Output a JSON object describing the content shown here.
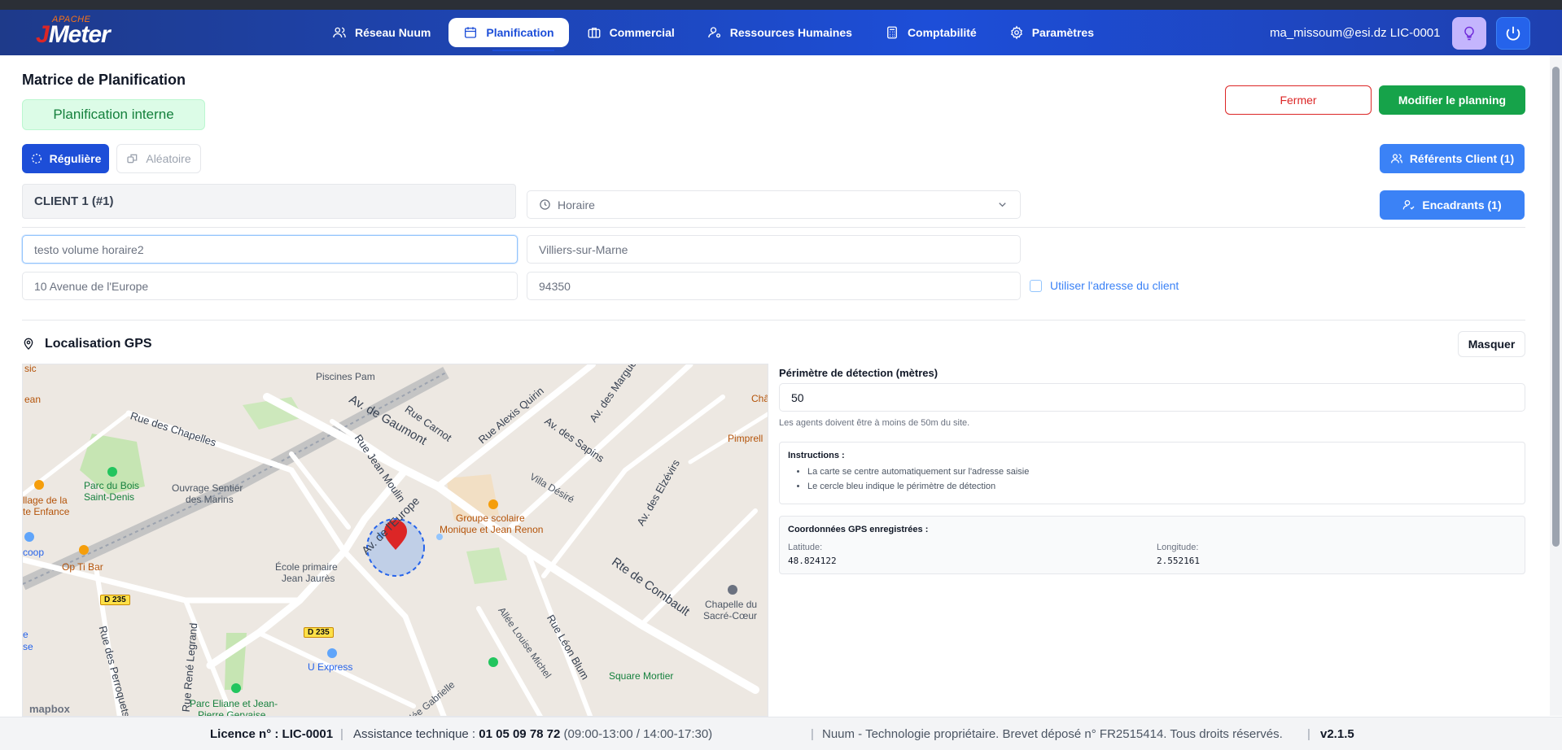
{
  "app": {
    "logo_top": "APACHE",
    "logo_main_j": "J",
    "logo_main_rest": "Meter"
  },
  "nav": {
    "items": [
      {
        "label": "Réseau Nuum",
        "icon": "users-icon"
      },
      {
        "label": "Planification",
        "icon": "calendar-icon",
        "active": true
      },
      {
        "label": "Commercial",
        "icon": "briefcase-icon"
      },
      {
        "label": "Ressources Humaines",
        "icon": "user-cog-icon"
      },
      {
        "label": "Comptabilité",
        "icon": "calculator-icon"
      },
      {
        "label": "Paramètres",
        "icon": "gear-icon"
      }
    ],
    "user_email": "ma_missoum@esi.dz LIC-0001"
  },
  "page": {
    "title": "Matrice de Planification",
    "badge": "Planification interne",
    "close_label": "Fermer",
    "modify_label": "Modifier le planning",
    "mode_regular": "Régulière",
    "mode_random": "Aléatoire",
    "referents_label": "Référents Client (1)",
    "encadrants_label": "Encadrants (1)",
    "client_name": "CLIENT 1 (#1)",
    "schedule_type": "Horaire"
  },
  "form": {
    "site_name": "testo volume horaire2",
    "city": "Villiers-sur-Marne",
    "address": "10 Avenue de l'Europe",
    "postal_code": "94350",
    "use_client_address_label": "Utiliser l'adresse du client"
  },
  "gps": {
    "title": "Localisation GPS",
    "hide_label": "Masquer",
    "perimeter_label": "Périmètre de détection (mètres)",
    "perimeter_value": "50",
    "perimeter_hint": "Les agents doivent être à moins de 50m du site.",
    "instructions_title": "Instructions :",
    "instructions": [
      "La carte se centre automatiquement sur l'adresse saisie",
      "Le cercle bleu indique le périmètre de détection"
    ],
    "coords_title": "Coordonnées GPS enregistrées :",
    "latitude_label": "Latitude:",
    "latitude": "48.824122",
    "longitude_label": "Longitude:",
    "longitude": "2.552161"
  },
  "map": {
    "labels": {
      "piscines": "Piscines Pam",
      "rue_chapelles": "Rue des Chapelles",
      "av_gaumont": "Av. de Gaumont",
      "rue_carnot": "Rue Carnot",
      "rue_quirin": "Rue Alexis Quirin",
      "av_sapins": "Av. des Sapins",
      "av_margue": "Av. des Margue",
      "pimprelle": "Pimprell",
      "cha": "Châ",
      "parc_bois_1": "Parc du Bois",
      "parc_bois_2": "Saint-Denis",
      "ouvrage_1": "Ouvrage Sentier",
      "ouvrage_2": "des Marins",
      "rue_moulin": "Rue Jean Moulin",
      "villa_desire": "Villa Désiré",
      "av_elzevirs": "Av. des Elzévirs",
      "groupe_1": "Groupe scolaire",
      "groupe_2": "Monique et Jean Renon",
      "village_1": "llage de la",
      "village_2": "te Enfance",
      "coop": "coop",
      "op_ti_bar": "Op Ti Bar",
      "ecole_1": "École primaire",
      "ecole_2": "Jean Jaurès",
      "av_europe": "Av. de l'Europe",
      "rte_combault": "Rte de Combault",
      "chapelle_1": "Chapelle du",
      "chapelle_2": "Sacré-Cœur",
      "d235_a": "D 235",
      "d235_b": "D 235",
      "rue_legrand": "Rue René Legrand",
      "rue_perroquets": "Rue des Perroquets",
      "u_express": "U Express",
      "allee_michel": "Allée Louise Michel",
      "rue_blum": "Rue Léon Blum",
      "square_mortier": "Square Mortier",
      "allee_gabrielle": "Allée Gabrielle",
      "parc_eliane_1": "Parc Eliane et Jean-",
      "parc_eliane_2": "Pierre Gervaise",
      "mapbox": "mapbox",
      "ean": "ean",
      "sic": "sic",
      "se": "se",
      "e": "e"
    }
  },
  "footer": {
    "license_prefix": "Licence n° :",
    "license": "LIC-0001",
    "support_prefix": "Assistance technique :",
    "phone": "01 05 09 78 72",
    "hours": "(09:00-13:00 / 14:00-17:30)",
    "legal": "Nuum - Technologie propriétaire. Brevet déposé n° FR2515414. Tous droits réservés.",
    "version": "v2.1.5"
  },
  "colors": {
    "nav_bg": "#1e40af",
    "primary": "#1d4ed8",
    "success": "#16a34a",
    "danger": "#dc2626",
    "info": "#3b82f6"
  }
}
